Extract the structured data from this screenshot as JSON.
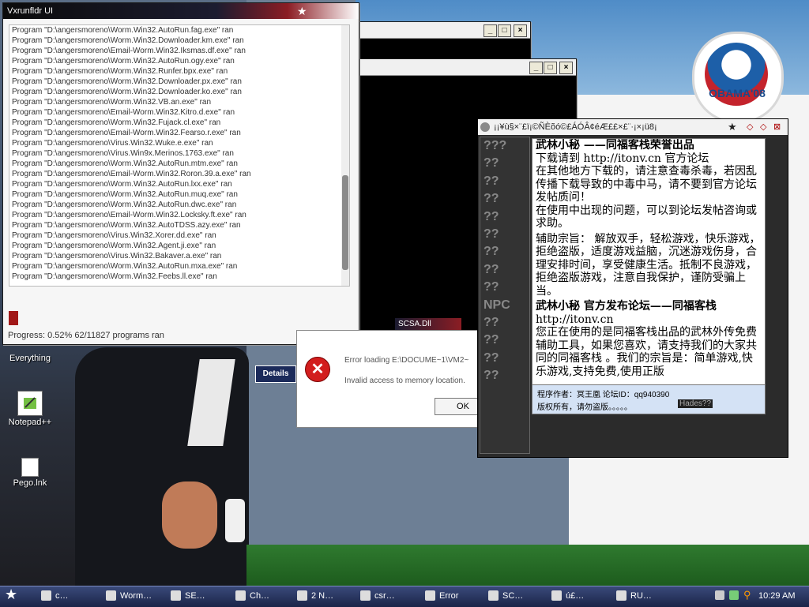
{
  "desktop": {
    "wallpaper_text": "OBAMA'08",
    "icons": [
      {
        "label": "Everything"
      },
      {
        "label": "Notepad++"
      },
      {
        "label": "Pego.lnk"
      }
    ]
  },
  "main_window": {
    "title": "Vxrunfldr UI",
    "log": [
      "Program \"D:\\angersmoreno\\Worm.Win32.AutoRun.fag.exe\" ran",
      "Program \"D:\\angersmoreno\\Worm.Win32.Downloader.km.exe\" ran",
      "Program \"D:\\angersmoreno\\Email-Worm.Win32.Iksmas.df.exe\" ran",
      "Program \"D:\\angersmoreno\\Worm.Win32.AutoRun.ogy.exe\" ran",
      "Program \"D:\\angersmoreno\\Worm.Win32.Runfer.bpx.exe\" ran",
      "Program \"D:\\angersmoreno\\Worm.Win32.Downloader.px.exe\" ran",
      "Program \"D:\\angersmoreno\\Worm.Win32.Downloader.ko.exe\" ran",
      "Program \"D:\\angersmoreno\\Worm.Win32.VB.an.exe\" ran",
      "Program \"D:\\angersmoreno\\Email-Worm.Win32.Kitro.d.exe\" ran",
      "Program \"D:\\angersmoreno\\Worm.Win32.Fujack.cl.exe\" ran",
      "Program \"D:\\angersmoreno\\Email-Worm.Win32.Fearso.r.exe\" ran",
      "Program \"D:\\angersmoreno\\Virus.Win32.Wuke.e.exe\" ran",
      "Program \"D:\\angersmoreno\\Virus.Win9x.Merinos.1763.exe\" ran",
      "Program \"D:\\angersmoreno\\Worm.Win32.AutoRun.mtm.exe\" ran",
      "Program \"D:\\angersmoreno\\Email-Worm.Win32.Roron.39.a.exe\" ran",
      "Program \"D:\\angersmoreno\\Worm.Win32.AutoRun.lxx.exe\" ran",
      "Program \"D:\\angersmoreno\\Worm.Win32.AutoRun.muq.exe\" ran",
      "Program \"D:\\angersmoreno\\Worm.Win32.AutoRun.dwc.exe\" ran",
      "Program \"D:\\angersmoreno\\Email-Worm.Win32.Locksky.ft.exe\" ran",
      "Program \"D:\\angersmoreno\\Worm.Win32.AutoTDSS.azy.exe\" ran",
      "Program \"D:\\angersmoreno\\Virus.Win32.Xorer.dd.exe\" ran",
      "Program \"D:\\angersmoreno\\Worm.Win32.Agent.ji.exe\" ran",
      "Program \"D:\\angersmoreno\\Virus.Win32.Bakaver.a.exe\" ran",
      "Program \"D:\\angersmoreno\\Worm.Win32.AutoRun.mxa.exe\" ran",
      "Program \"D:\\angersmoreno\\Worm.Win32.Feebs.ll.exe\" ran"
    ],
    "progress_text": "Progress: 0.52% 62/11827 programs ran",
    "progress_fraction": 0.0052
  },
  "error_dialog": {
    "title": "SCSA.Dll",
    "message1": "Error loading E:\\DOCUME~1\\VM2~",
    "message2": "Invalid access to memory location.",
    "ok_label": "OK",
    "details_label": "Details"
  },
  "cn_window": {
    "title": "¡¡¥ù§×¨£ï¡©ÑÈõó©£ÁÓÂ¢éÆ££×£¨·¡×¡ü8¡",
    "nav": [
      "???",
      "??",
      "??",
      "??",
      "??",
      "??",
      "??",
      "??",
      "??",
      "NPC",
      "??",
      "??",
      "??",
      "??"
    ],
    "para1": "  武林小秘 ——同福客栈荣誉出品",
    "para2": "下载请到 http://itonv.cn 官方论坛",
    "para3": "在其他地方下载的，请注意查毒杀毒，若因乱传播下载导致的中毒中马，请不要到官方论坛发帖质问！",
    "para4": "在使用中出现的问题，可以到论坛发帖咨询或求助。",
    "para5": "辅助宗旨： 解放双手，轻松游戏，快乐游戏，拒绝盗版，适度游戏益脑，沉迷游戏伤身，合理安排时间，享受健康生活。抵制不良游戏，拒绝盗版游戏，注意自我保护，谨防受骗上当。",
    "para6": " 武林小秘 官方发布论坛——同福客栈",
    "para7": "http://itonv.cn",
    "para8": "您正在使用的是同福客栈出品的武林外传免费辅助工具，如果您喜欢，请支持我们的大家共同的同福客栈 。我们的宗旨是：简单游戏,快乐游戏,支持免费,使用正版",
    "footer1": "程序作者：冥王凰      论坛ID：qq940390",
    "footer2": "版权所有，请勿盗版。。。。。",
    "footer_badge": "Hades??"
  },
  "taskbar": {
    "items": [
      "c…",
      "Worm…",
      "SE…",
      "Ch…",
      "2 N…",
      "csr…",
      "Error",
      "SC…",
      "ú£…",
      "RU…"
    ],
    "clock": "10:29 AM"
  }
}
